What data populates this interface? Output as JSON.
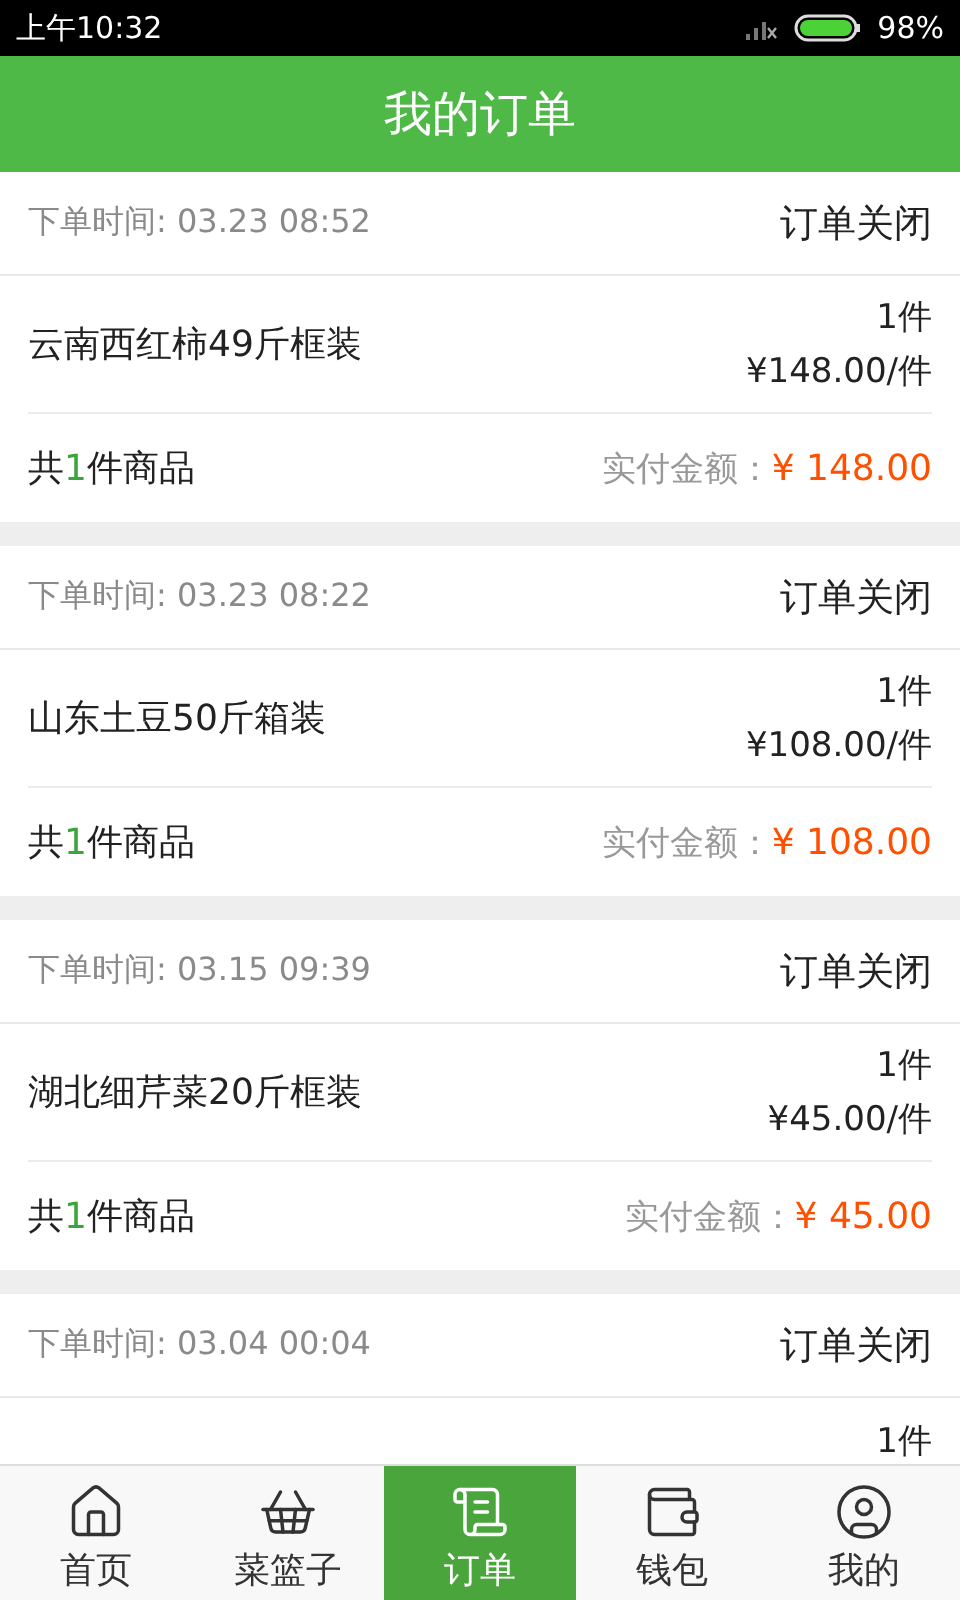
{
  "status_bar": {
    "time": "上午10:32",
    "battery": "98%"
  },
  "header": {
    "title": "我的订单"
  },
  "orders": [
    {
      "time": "下单时间: 03.23 08:52",
      "status": "订单关闭",
      "product": "云南西红柿49斤框装",
      "quantity": "1件",
      "unit_price": "¥148.00/件",
      "count_prefix": "共",
      "count": "1",
      "count_suffix": "件商品",
      "paid_label": "实付金额：",
      "paid": "¥ 148.00"
    },
    {
      "time": "下单时间: 03.23 08:22",
      "status": "订单关闭",
      "product": "山东土豆50斤箱装",
      "quantity": "1件",
      "unit_price": "¥108.00/件",
      "count_prefix": "共",
      "count": "1",
      "count_suffix": "件商品",
      "paid_label": "实付金额：",
      "paid": "¥ 108.00"
    },
    {
      "time": "下单时间: 03.15 09:39",
      "status": "订单关闭",
      "product": "湖北细芹菜20斤框装",
      "quantity": "1件",
      "unit_price": "¥45.00/件",
      "count_prefix": "共",
      "count": "1",
      "count_suffix": "件商品",
      "paid_label": "实付金额：",
      "paid": "¥ 45.00"
    },
    {
      "time": "下单时间: 03.04 00:04",
      "status": "订单关闭",
      "quantity": "1件"
    }
  ],
  "tab_bar": [
    {
      "kind": "home",
      "label": "首页",
      "selected": false
    },
    {
      "kind": "basket",
      "label": "菜篮子",
      "selected": false
    },
    {
      "kind": "orders",
      "label": "订单",
      "selected": true
    },
    {
      "kind": "wallet",
      "label": "钱包",
      "selected": false
    },
    {
      "kind": "profile",
      "label": "我的",
      "selected": false
    }
  ]
}
